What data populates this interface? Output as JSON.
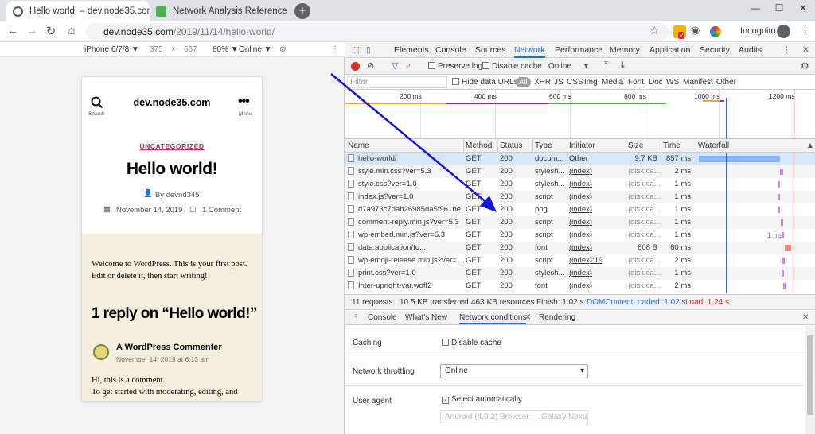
{
  "browser": {
    "tabs": [
      {
        "title": "Hello world! – dev.node35.com",
        "close": "×"
      },
      {
        "title": "Network Analysis Reference | To",
        "close": "×"
      }
    ],
    "new_tab": "+",
    "window_buttons": {
      "minimize": "—",
      "maximize": "☐",
      "close": "✕"
    },
    "nav": {
      "back": "←",
      "forward": "→",
      "reload": "↻",
      "home": "⌂"
    },
    "url_host": "dev.node35.com",
    "url_path": "/2019/11/14/hello-world/",
    "incognito_label": "Incognito",
    "extension_badge": "2"
  },
  "device_toolbar": {
    "device": "iPhone 6/7/8 ▼",
    "width": "375",
    "times": "×",
    "height": "667",
    "zoom": "80% ▼",
    "network": "Online ▼"
  },
  "page": {
    "site_title": "dev.node35.com",
    "search_label": "Search",
    "menu_label": "Menu",
    "category": "UNCATEGORIZED",
    "post_title": "Hello world!",
    "author": "By devnd345",
    "date": "November 14, 2019",
    "comments": "1 Comment",
    "body_line1": "Welcome to WordPress. This is your first post.",
    "body_line2": "Edit or delete it, then start writing!",
    "reply_heading": "1 reply on “Hello world!”",
    "commenter": "A WordPress Commenter",
    "comment_date": "November 14, 2019 at 6:13 am",
    "comment_line1": "Hi, this is a comment.",
    "comment_line2": "To get started with moderating, editing, and"
  },
  "devtools": {
    "tabs": [
      "Elements",
      "Console",
      "Sources",
      "Network",
      "Performance",
      "Memory",
      "Application",
      "Security",
      "Audits"
    ],
    "active_tab": "Network",
    "toolbar": {
      "preserve_log": "Preserve log",
      "disable_cache": "Disable cache",
      "throttle": "Online",
      "filter_placeholder": "Filter",
      "hide_data_urls": "Hide data URLs",
      "types": [
        "All",
        "XHR",
        "JS",
        "CSS",
        "Img",
        "Media",
        "Font",
        "Doc",
        "WS",
        "Manifest",
        "Other"
      ]
    },
    "timeline_ticks": [
      "200 ms",
      "400 ms",
      "600 ms",
      "800 ms",
      "1000 ms",
      "1200 ms"
    ],
    "columns": [
      "Name",
      "Method",
      "Status",
      "Type",
      "Initiator",
      "Size",
      "Time",
      "Waterfall"
    ],
    "requests": [
      {
        "name": "hello-world/",
        "method": "GET",
        "status": "200",
        "type": "docum...",
        "initiator": "Other",
        "size": "9.7 KB",
        "time": "857 ms"
      },
      {
        "name": "style.min.css?ver=5.3",
        "method": "GET",
        "status": "200",
        "type": "stylesh...",
        "initiator": "(index)",
        "size": "(disk ca...",
        "time": "2 ms"
      },
      {
        "name": "style.css?ver=1.0",
        "method": "GET",
        "status": "200",
        "type": "stylesh...",
        "initiator": "(index)",
        "size": "(disk ca...",
        "time": "1 ms"
      },
      {
        "name": "index.js?ver=1.0",
        "method": "GET",
        "status": "200",
        "type": "script",
        "initiator": "(index)",
        "size": "(disk ca...",
        "time": "1 ms"
      },
      {
        "name": "d7a973c7dab26985da5f961be...",
        "method": "GET",
        "status": "200",
        "type": "png",
        "initiator": "(index)",
        "size": "(disk ca...",
        "time": "1 ms"
      },
      {
        "name": "comment-reply.min.js?ver=5.3",
        "method": "GET",
        "status": "200",
        "type": "script",
        "initiator": "(index)",
        "size": "(disk ca...",
        "time": "1 ms"
      },
      {
        "name": "wp-embed.min.js?ver=5.3",
        "method": "GET",
        "status": "200",
        "type": "script",
        "initiator": "(index)",
        "size": "(disk ca...",
        "time": "1 ms"
      },
      {
        "name": "data:application/fo...",
        "method": "GET",
        "status": "200",
        "type": "font",
        "initiator": "(index)",
        "size": "808 B",
        "time": "60 ms"
      },
      {
        "name": "wp-emoji-release.min.js?ver=...",
        "method": "GET",
        "status": "200",
        "type": "script",
        "initiator": "(index):19",
        "size": "(disk ca...",
        "time": "2 ms"
      },
      {
        "name": "print.css?ver=1.0",
        "method": "GET",
        "status": "200",
        "type": "stylesh...",
        "initiator": "(index)",
        "size": "(disk ca...",
        "time": "1 ms"
      },
      {
        "name": "Inter-upright-var.woff2",
        "method": "GET",
        "status": "200",
        "type": "font",
        "initiator": "(index)",
        "size": "(disk ca...",
        "time": "2 ms"
      }
    ],
    "waterfall_tooltip": "1 ms",
    "summary": {
      "requests": "11 requests",
      "transferred": "10.5 KB transferred",
      "resources": "463 KB resources",
      "finish": "Finish: 1.02 s",
      "dcl": "DOMContentLoaded: 1.02 s",
      "load": "Load: 1.24 s"
    },
    "drawer_tabs": [
      "Console",
      "What's New",
      "Network conditions",
      "Rendering"
    ],
    "drawer_active": "Network conditions",
    "conditions": {
      "caching_label": "Caching",
      "disable_cache": "Disable cache",
      "throttling_label": "Network throttling",
      "throttling_value": "Online",
      "ua_label": "User agent",
      "select_auto": "Select automatically",
      "ua_value": "Android (4.0.2) Browser — Galaxy Nexus"
    }
  },
  "colors": {
    "link": "#1a73e8",
    "dcl": "#1a73e8",
    "load": "#d93025",
    "category": "#cd2653",
    "annotation_arrow": "#1515d8",
    "beige": "#f5efe0"
  }
}
